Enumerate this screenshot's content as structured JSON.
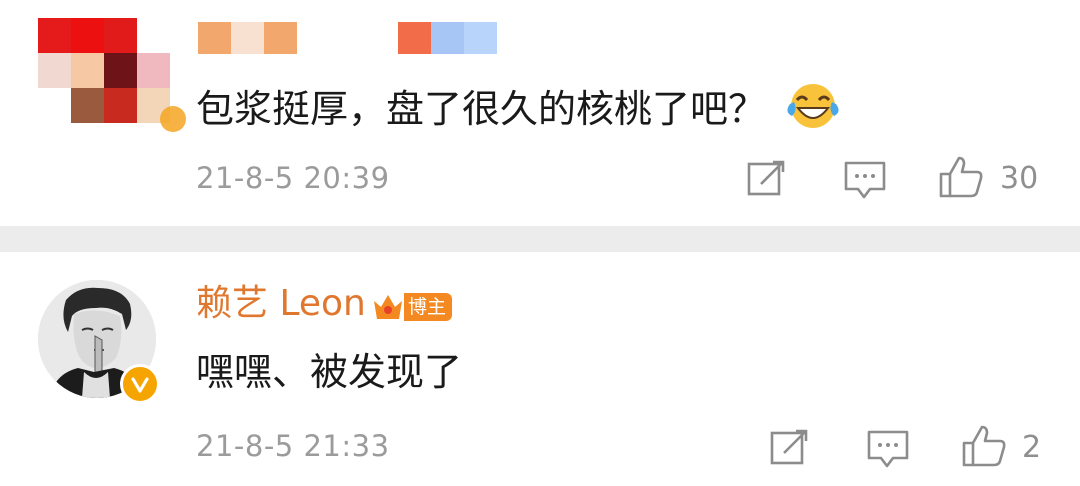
{
  "comments": [
    {
      "text": "包浆挺厚，盘了很久的核桃了吧？",
      "emoji": "laugh-cry-icon",
      "time": "21-8-5 20:39",
      "likes": "30"
    },
    {
      "author": "赖艺 Leon",
      "badge": "博主",
      "text": "嘿嘿、被发现了",
      "time": "21-8-5 21:33",
      "likes": "2"
    }
  ],
  "colors": {
    "author_name": "#e0772f",
    "badge_bg": "#f38920",
    "verify": "#f6a400",
    "meta": "#9b9b9b",
    "separator": "#ececec"
  }
}
